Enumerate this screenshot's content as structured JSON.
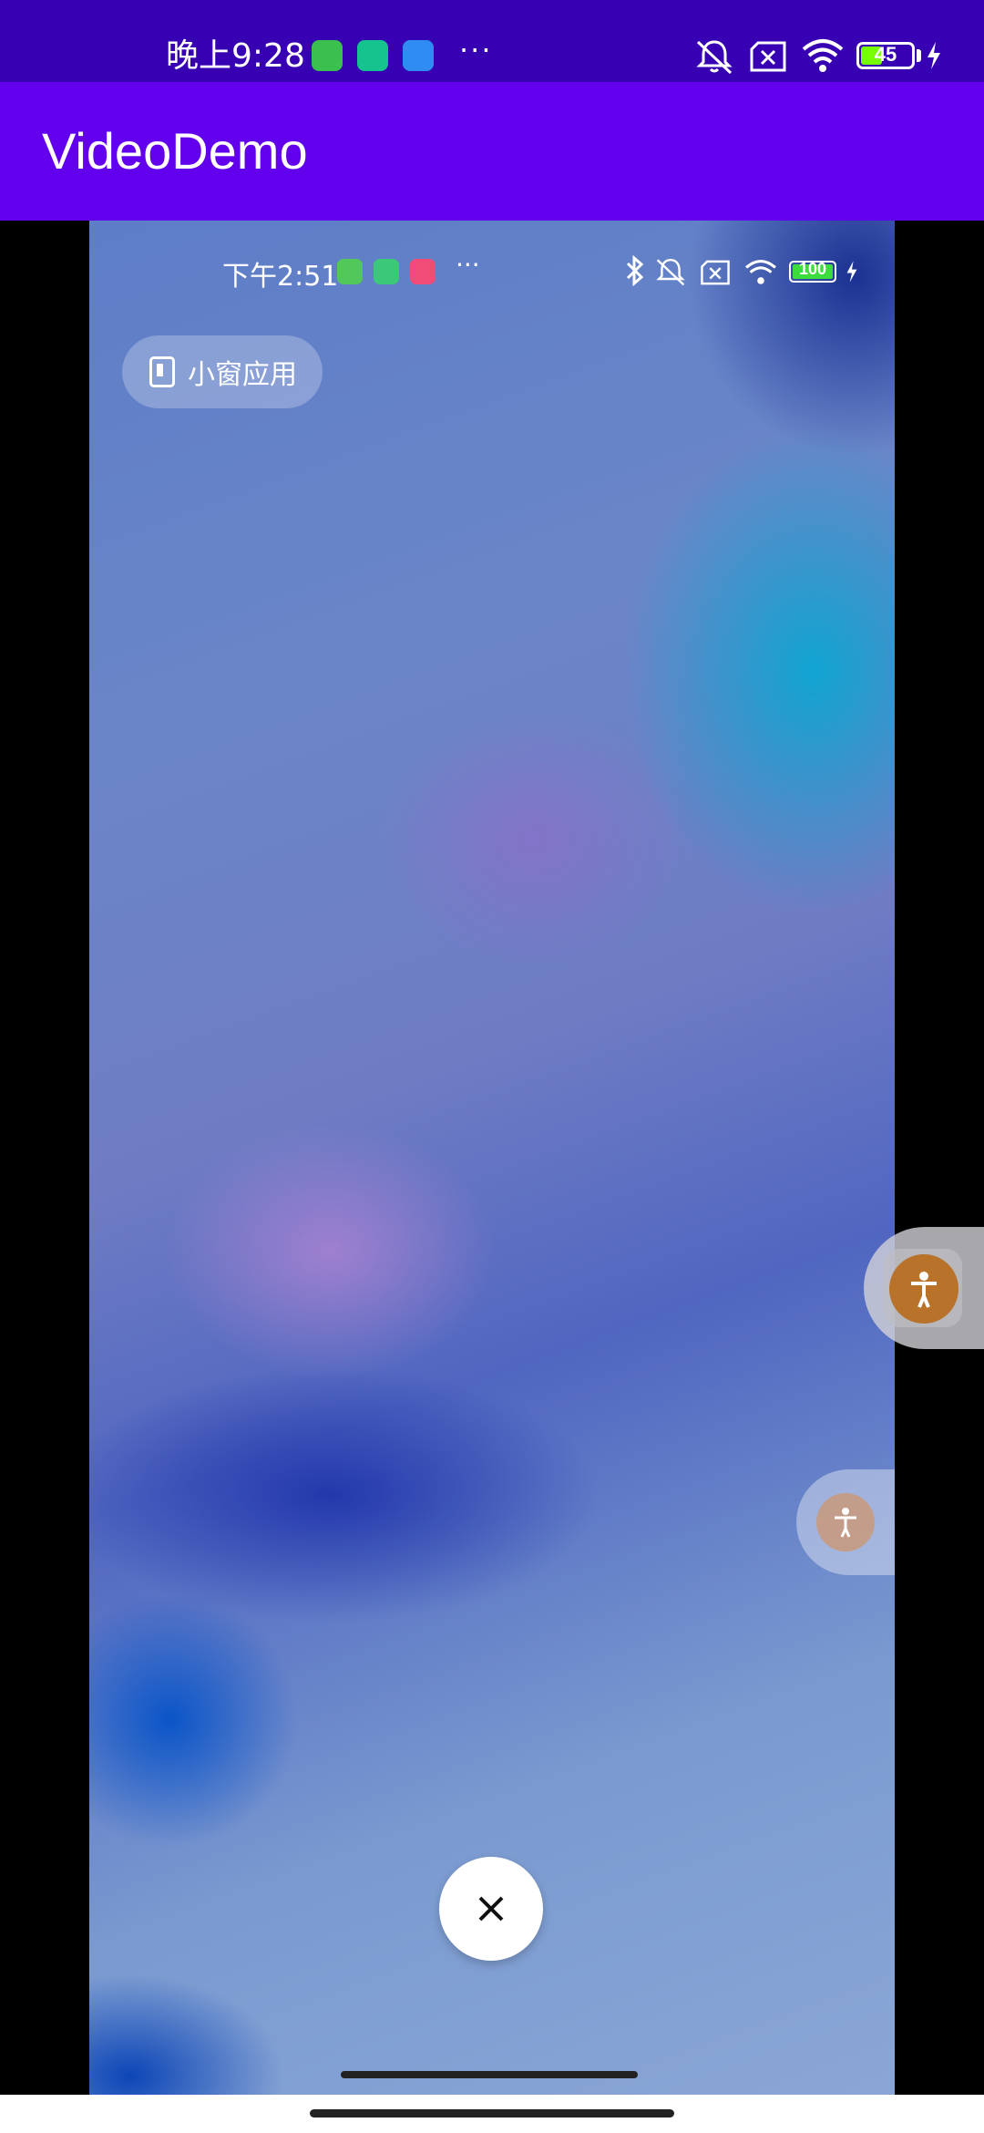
{
  "status_bar": {
    "time": "晚上9:28",
    "more": "···",
    "battery": "45",
    "icons": [
      "green-robot-icon",
      "shield-icon",
      "blue-app-icon",
      "mute-bell-icon",
      "sim-x-icon",
      "wifi-icon",
      "battery-icon",
      "charging-icon"
    ]
  },
  "app_bar": {
    "title": "VideoDemo"
  },
  "video": {
    "inner_status": {
      "time": "下午2:51",
      "more": "···",
      "battery": "100",
      "icons": [
        "green-robot-icon",
        "android-icon",
        "pink-app-icon",
        "bluetooth-icon",
        "mute-bell-icon",
        "sim-x-icon",
        "wifi-icon",
        "battery-icon",
        "charging-icon"
      ]
    },
    "pip_chip": {
      "label": "小窗应用",
      "icon": "window-icon"
    },
    "close_icon": "close-icon",
    "accessibility_icon": "accessibility-icon"
  },
  "floating": {
    "icon": "accessibility-icon"
  },
  "colors": {
    "status_bar": "#3700b3",
    "app_bar": "#6200ee",
    "accessibility_dot": "#b8722a"
  }
}
